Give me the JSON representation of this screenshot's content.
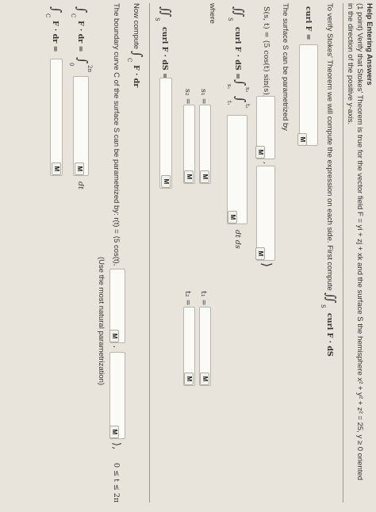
{
  "header": {
    "help_link": "Help Entering Answers",
    "problem_line": "(1 point) Verify that Stokes' Theorem is true for the vector field F = yi + zj + xk and the surface S the hemisphere x² + y² + z² = 25, y ≥ 0 oriented",
    "problem_line2": "in the direction of the positive y-axis."
  },
  "intro": {
    "text": "To verify Stokes' Theorem we will compute the expression on each side. First compute",
    "integral": "∬",
    "sub": "S",
    "expr": "curl F · dS"
  },
  "curl": {
    "label": "curl F =",
    "button": "M"
  },
  "param": {
    "text": "The surface S can be parametrized by",
    "lhs": "S(s, t) = ⟨5 cos(t) sin(s),",
    "close": "⟩",
    "button1": "M",
    "button2": "M"
  },
  "surface_integral": {
    "lhs": "curl F · dS =",
    "int": "∬",
    "sub": "S",
    "r1": "∫",
    "r1_sub": "s₁",
    "r1_sup": "s₂",
    "r2": "∫",
    "r2_sub": "t₁",
    "r2_sup": "t₂",
    "tail": "dt ds",
    "button": "M"
  },
  "where": {
    "label": "where",
    "s1": "s₁ =",
    "s2": "s₂ =",
    "t1": "t₁ =",
    "t2": "t₂ =",
    "buttons": [
      "M",
      "M",
      "M",
      "M"
    ]
  },
  "result": {
    "int": "∬",
    "sub": "S",
    "expr": "curl F · dS =",
    "button": "M"
  },
  "line": {
    "now": "Now compute",
    "int": "∫",
    "sub": "C",
    "expr": "F · dr",
    "boundary": "The boundary curve C of the surface S can be parametrized by: r(t) = ⟨5 cos(t),",
    "close": "⟩,",
    "range": "0 ≤ t ≤ 2π",
    "note": "(Use the most natural parametrization)",
    "buttons": [
      "M",
      "M"
    ]
  },
  "line_integral": {
    "lhs": "F · dr =",
    "int": "∫",
    "sub": "C",
    "r": "∫",
    "r_sub": "0",
    "r_sup": "2π",
    "tail": "dt",
    "button": "M"
  },
  "final": {
    "int": "∫",
    "sub": "C",
    "expr": "F · dr =",
    "button": "M"
  }
}
